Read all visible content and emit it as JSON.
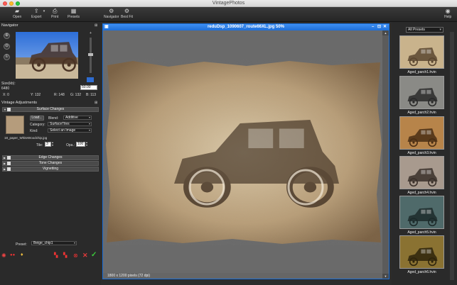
{
  "window": {
    "title": "VintagePhotos"
  },
  "toolbar": {
    "open": "Open",
    "export": "Export",
    "print": "Print",
    "presets": "Presets",
    "navigator": "Navigator",
    "best_fit": "Best Fit",
    "help": "Help"
  },
  "navigator": {
    "heading": "Navigator",
    "size_label": "Size(kb):",
    "size_value": "6480",
    "zoom": "50.00",
    "x": "X: 0",
    "y": "Y: 132",
    "r": "R: 148",
    "g": "G: 132",
    "b": "B: 113"
  },
  "adjustments": {
    "heading": "Vintage Adjustments",
    "surface": {
      "title": "Surface Changes",
      "load_label": "Load...",
      "blend_label": "Blend:",
      "blend_value": "Additive",
      "category_label": "Category:",
      "category_value": "SurfaceTiles",
      "kind_label": "Kind:",
      "kind_value": "Select an Image",
      "filename": "18_paper_WhiteWoodchip.jpg",
      "tile_label": "Tile:",
      "tile_value": "3",
      "opa_label": "Opa.:",
      "opa_value": "100"
    },
    "edge": "Edge Changes",
    "tone": "Tone Changes",
    "vignetting": "Vignetting"
  },
  "preset_bar": {
    "label": "Preset:",
    "value": "Beige_chip1"
  },
  "document": {
    "title": "reduDsp_1090607_route66XL.jpg 50%",
    "status": "1800 x 1200 pixels (72 dpi)"
  },
  "presets_panel": {
    "filter": "All Presets",
    "items": [
      {
        "label": "Aged_parch1.hvin"
      },
      {
        "label": "Aged_parch2.hvin"
      },
      {
        "label": "Aged_parch3.hvin"
      },
      {
        "label": "Aged_parch4.hvin"
      },
      {
        "label": "Aged_parch5.hvin"
      },
      {
        "label": "Aged_parch6.hvin"
      }
    ]
  },
  "colors": {
    "accent": "#1e6fd9",
    "apply_check": "#3bcb3b",
    "cancel_x": "#e03a3a"
  }
}
